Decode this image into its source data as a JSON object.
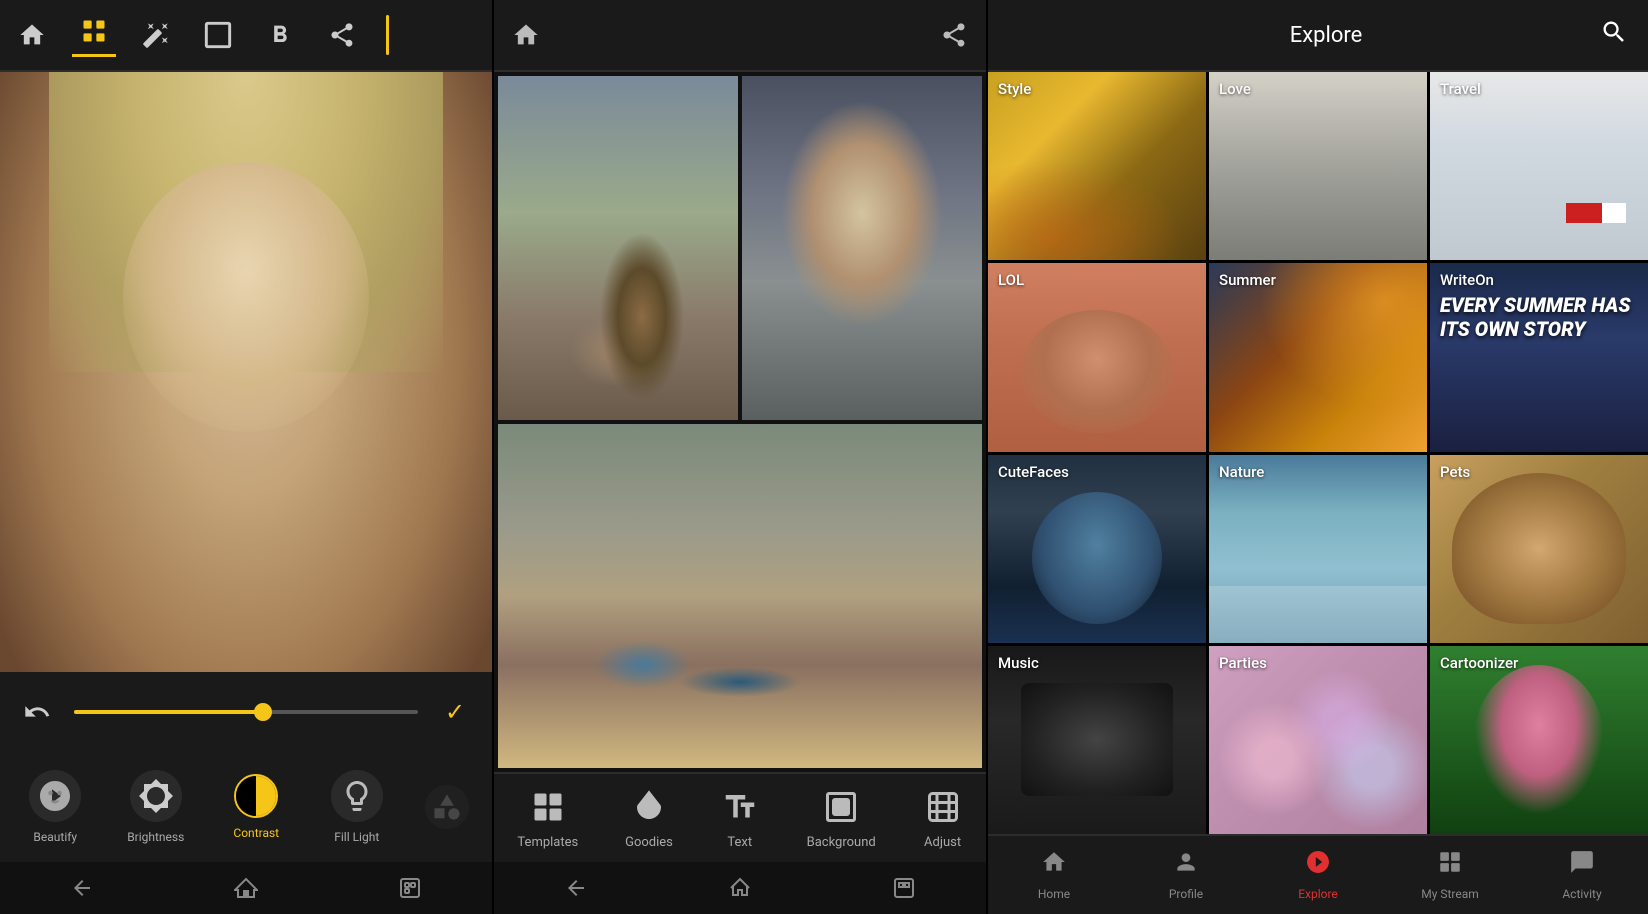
{
  "panel1": {
    "toolbar": {
      "home_icon": "⌂",
      "tools_icon": "⚙",
      "wand_icon": "✦",
      "frame_icon": "▭",
      "bold_icon": "B",
      "share_icon": "↑"
    },
    "tools": [
      {
        "id": "beautify",
        "label": "Beautify",
        "type": "face",
        "active": false
      },
      {
        "id": "brightness",
        "label": "Brightness",
        "type": "sun",
        "active": false
      },
      {
        "id": "contrast",
        "label": "Contrast",
        "type": "contrast",
        "active": true
      },
      {
        "id": "filllight",
        "label": "Fill Light",
        "type": "bulb",
        "active": false
      }
    ],
    "slider_percent": 55,
    "nav": [
      "←",
      "⌂",
      "☐"
    ]
  },
  "panel2": {
    "toolbar": {
      "home_icon": "⌂",
      "share_icon": "↑"
    },
    "bottom_tools": [
      {
        "id": "templates",
        "label": "Templates",
        "icon": "⊞"
      },
      {
        "id": "goodies",
        "label": "Goodies",
        "icon": "⬡"
      },
      {
        "id": "text",
        "label": "Text",
        "icon": "B"
      },
      {
        "id": "background",
        "label": "Background",
        "icon": "◱"
      },
      {
        "id": "adjust",
        "label": "Adjust",
        "icon": "⊡"
      }
    ],
    "nav": [
      "←",
      "⌂",
      "☐"
    ]
  },
  "panel3": {
    "header": {
      "title": "Explore",
      "search_icon": "🔍"
    },
    "grid_items": [
      {
        "id": "style",
        "label": "Style",
        "bg": "style"
      },
      {
        "id": "love",
        "label": "Love",
        "bg": "love"
      },
      {
        "id": "travel",
        "label": "Travel",
        "bg": "travel"
      },
      {
        "id": "lol",
        "label": "LOL",
        "bg": "lol"
      },
      {
        "id": "summer",
        "label": "Summer",
        "bg": "summer"
      },
      {
        "id": "writeon",
        "label": "WriteOn",
        "bg": "writeon",
        "overlay_text": "EVERY SUMMER HAS ITS OWN STORY"
      },
      {
        "id": "cutefaces",
        "label": "CuteFaces",
        "bg": "cutefaces"
      },
      {
        "id": "nature",
        "label": "Nature",
        "bg": "nature"
      },
      {
        "id": "pets",
        "label": "Pets",
        "bg": "pets"
      },
      {
        "id": "music",
        "label": "Music",
        "bg": "music"
      },
      {
        "id": "parties",
        "label": "Parties",
        "bg": "parties"
      },
      {
        "id": "cartoonizer",
        "label": "Cartoonizer",
        "bg": "cartoonizer"
      }
    ],
    "nav": [
      {
        "id": "home",
        "label": "Home",
        "icon": "⌂",
        "active": false
      },
      {
        "id": "profile",
        "label": "Profile",
        "icon": "👤",
        "active": false
      },
      {
        "id": "explore",
        "label": "Explore",
        "icon": "🌐",
        "active": true
      },
      {
        "id": "mystream",
        "label": "My Stream",
        "icon": "⊞",
        "active": false
      },
      {
        "id": "activity",
        "label": "Activity",
        "icon": "💬",
        "active": false
      }
    ]
  }
}
